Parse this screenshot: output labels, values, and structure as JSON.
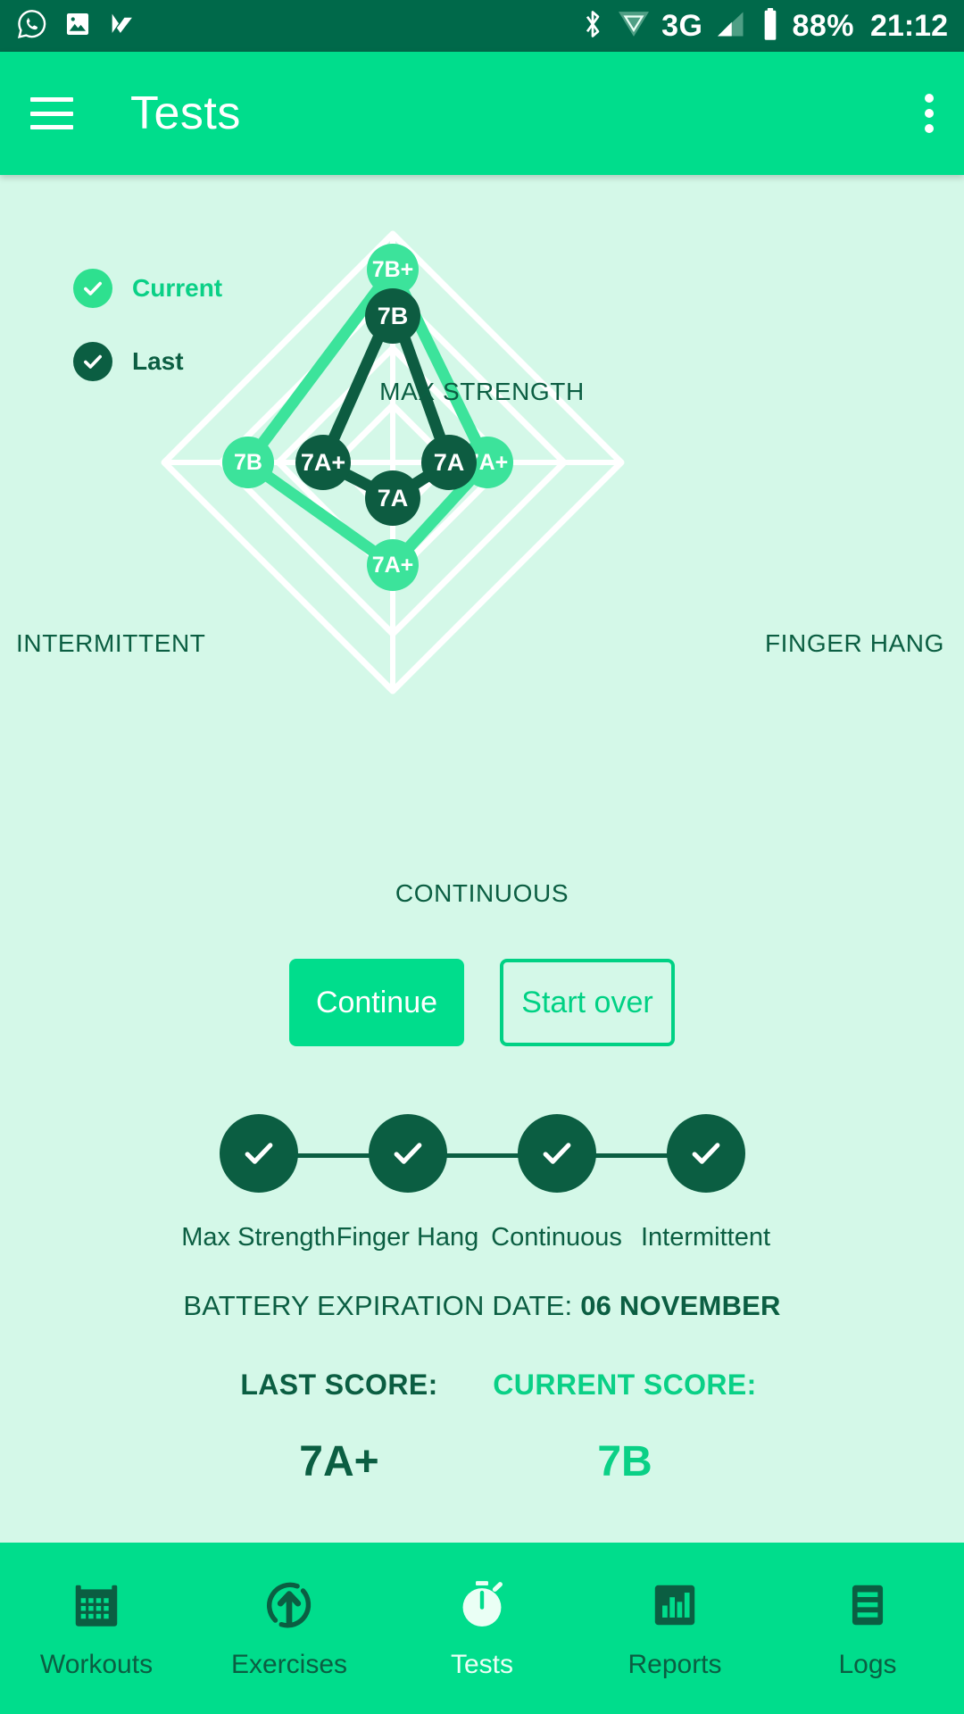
{
  "statusbar": {
    "icons_left": [
      "whatsapp-icon",
      "gallery-icon",
      "checkmark-app-icon"
    ],
    "icons_right": [
      "bluetooth-icon",
      "wifi-icon",
      "signal-icon"
    ],
    "network": "3G",
    "battery": "88%",
    "time": "21:12"
  },
  "appbar": {
    "menu_icon": "hamburger-icon",
    "title": "Tests",
    "overflow_icon": "overflow-menu-icon"
  },
  "legend": {
    "current": "Current",
    "last": "Last"
  },
  "chart_data": {
    "type": "radar",
    "title": "",
    "categories": [
      "MAX STRENGTH",
      "FINGER HANG",
      "CONTINUOUS",
      "INTERMITTENT"
    ],
    "scale_labels": [
      "7A",
      "7A+",
      "7B",
      "7B+"
    ],
    "series": [
      {
        "name": "Current",
        "color": "#3ce39b",
        "values": [
          "7B+",
          "7A+",
          "7A+",
          "7B"
        ],
        "levels": [
          4,
          2,
          2,
          3
        ]
      },
      {
        "name": "Last",
        "color": "#0d5c41",
        "values": [
          "7B",
          "7A",
          "7A",
          "7A+"
        ],
        "levels": [
          3,
          1,
          1,
          2
        ]
      }
    ],
    "grid": true,
    "legend_position": "left"
  },
  "actions": {
    "continue": "Continue",
    "start_over": "Start over"
  },
  "steps": [
    {
      "label": "Max Strength",
      "state": "complete"
    },
    {
      "label": "Finger Hang",
      "state": "complete"
    },
    {
      "label": "Continuous",
      "state": "complete"
    },
    {
      "label": "Intermittent",
      "state": "complete"
    }
  ],
  "battery_expiration": {
    "label": "BATTERY EXPIRATION DATE:",
    "value": "06 NOVEMBER"
  },
  "scores": {
    "last_label": "LAST SCORE:",
    "last_value": "7A+",
    "current_label": "CURRENT SCORE:",
    "current_value": "7B"
  },
  "bottomnav": [
    {
      "label": "Workouts",
      "icon": "calendar-icon",
      "active": false
    },
    {
      "label": "Exercises",
      "icon": "circular-arrow-up-icon",
      "active": false
    },
    {
      "label": "Tests",
      "icon": "stopwatch-icon",
      "active": true
    },
    {
      "label": "Reports",
      "icon": "bar-chart-icon",
      "active": false
    },
    {
      "label": "Logs",
      "icon": "list-icon",
      "active": false
    }
  ],
  "colors": {
    "accent": "#00dd8c",
    "dark": "#0b5e42",
    "background": "#d4f8e8",
    "statusbar": "#00694a"
  }
}
